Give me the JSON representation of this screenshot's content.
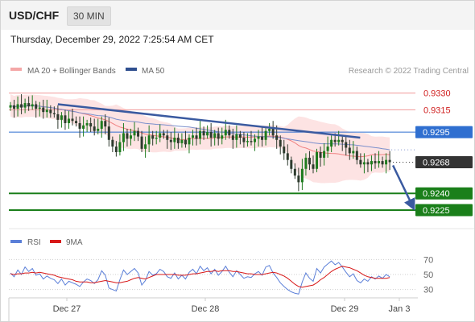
{
  "header": {
    "symbol": "USD/CHF",
    "timeframe": "30 MIN",
    "datetime": "Thursday, December 29, 2022 7:25:54 AM CET"
  },
  "legend": {
    "ma20": "MA 20 + Bollinger Bands",
    "ma50": "MA 50",
    "credit": "Research © 2022 Trading Central"
  },
  "rsi_legend": {
    "rsi": "RSI",
    "ma9": "9MA"
  },
  "colors": {
    "candle_up": "#1e7b1e",
    "candle_down": "#2e3b2e",
    "band_fill": "#fde3e3",
    "ma20": "#f08080",
    "ma50": "#7b8fcc",
    "trendline": "#3a5aa0",
    "support": "#1a7f1a",
    "resistance": "#f19a9a",
    "pivot": "#2f6fd0",
    "current": "#333333",
    "rsi": "#5b7fd8",
    "rsi_ma": "#d81818"
  },
  "chart_data": [
    {
      "type": "candlestick",
      "title": "USD/CHF",
      "ylim": [
        0.9212,
        0.9342
      ],
      "x_ticks": [
        "Dec 27",
        "Dec 28",
        "Dec 29",
        "Jan 3"
      ],
      "price_levels": [
        {
          "label": "0.9330",
          "value": 0.933,
          "kind": "resistance"
        },
        {
          "label": "0.9315",
          "value": 0.9315,
          "kind": "resistance"
        },
        {
          "label": "0.9295",
          "value": 0.9295,
          "kind": "pivot"
        },
        {
          "label": "0.9268",
          "value": 0.9268,
          "kind": "current"
        },
        {
          "label": "0.9240",
          "value": 0.924,
          "kind": "support"
        },
        {
          "label": "0.9225",
          "value": 0.9225,
          "kind": "support"
        }
      ],
      "series": [
        {
          "name": "Price",
          "close": [
            0.9319,
            0.9316,
            0.932,
            0.9317,
            0.9321,
            0.9318,
            0.932,
            0.9316,
            0.9317,
            0.9313,
            0.9315,
            0.9312,
            0.9311,
            0.9306,
            0.931,
            0.9303,
            0.9307,
            0.9305,
            0.9303,
            0.9298,
            0.9301,
            0.9303,
            0.93,
            0.9296,
            0.9298,
            0.9305,
            0.93,
            0.9288,
            0.9282,
            0.9277,
            0.9286,
            0.9294,
            0.9289,
            0.9292,
            0.9296,
            0.9291,
            0.928,
            0.9284,
            0.9292,
            0.9289,
            0.929,
            0.9294,
            0.9292,
            0.9288,
            0.9286,
            0.929,
            0.9285,
            0.9288,
            0.9284,
            0.929,
            0.9292,
            0.9289,
            0.9296,
            0.9292,
            0.9295,
            0.929,
            0.9294,
            0.9289,
            0.9292,
            0.9297,
            0.9292,
            0.9288,
            0.9293,
            0.929,
            0.9286,
            0.9287,
            0.9286,
            0.9289,
            0.9291,
            0.9288,
            0.9296,
            0.9298,
            0.9292,
            0.9288,
            0.9282,
            0.9276,
            0.927,
            0.9262,
            0.9256,
            0.925,
            0.9262,
            0.9272,
            0.9266,
            0.9262,
            0.9277,
            0.9272,
            0.9278,
            0.9282,
            0.9288,
            0.9286,
            0.9288,
            0.9286,
            0.9281,
            0.9276,
            0.9278,
            0.927,
            0.9266,
            0.9268,
            0.9266,
            0.9269,
            0.9267,
            0.9269,
            0.9266,
            0.927,
            0.9268
          ]
        },
        {
          "name": "MA 20"
        },
        {
          "name": "MA 50"
        }
      ],
      "trendline": {
        "from": {
          "index": 13,
          "value": 0.932
        },
        "to": {
          "index": 129,
          "value": 0.929
        }
      },
      "projection": {
        "to_value": 0.9225
      }
    },
    {
      "type": "line",
      "title": "RSI",
      "ylim": [
        20,
        80
      ],
      "y_ticks": [
        70,
        50,
        30
      ],
      "series": [
        {
          "name": "RSI",
          "values": [
            52,
            47,
            56,
            50,
            60,
            54,
            58,
            49,
            51,
            44,
            48,
            45,
            43,
            38,
            44,
            36,
            41,
            39,
            37,
            34,
            40,
            44,
            42,
            38,
            43,
            55,
            49,
            32,
            30,
            28,
            43,
            56,
            50,
            54,
            58,
            52,
            36,
            42,
            54,
            49,
            51,
            57,
            54,
            47,
            45,
            52,
            44,
            49,
            44,
            53,
            57,
            51,
            61,
            55,
            59,
            51,
            57,
            49,
            54,
            61,
            53,
            47,
            55,
            50,
            45,
            47,
            46,
            51,
            54,
            49,
            60,
            62,
            52,
            46,
            39,
            34,
            30,
            27,
            25,
            24,
            40,
            52,
            45,
            41,
            58,
            52,
            60,
            64,
            68,
            63,
            66,
            60,
            53,
            47,
            51,
            42,
            39,
            44,
            41,
            47,
            44,
            48,
            45,
            50,
            47
          ]
        },
        {
          "name": "9MA",
          "values": [
            51,
            50,
            51,
            51,
            52,
            52,
            53,
            52,
            53,
            52,
            51,
            50,
            49,
            47,
            46,
            45,
            44,
            43,
            41,
            40,
            40,
            40,
            39,
            39,
            40,
            41,
            42,
            41,
            40,
            39,
            39,
            40,
            41,
            43,
            45,
            46,
            45,
            44,
            46,
            48,
            50,
            50,
            50,
            50,
            50,
            50,
            49,
            49,
            49,
            50,
            51,
            51,
            52,
            53,
            54,
            54,
            55,
            54,
            55,
            55,
            55,
            54,
            54,
            53,
            52,
            51,
            51,
            50,
            50,
            50,
            51,
            52,
            53,
            52,
            50,
            48,
            45,
            41,
            37,
            34,
            33,
            34,
            35,
            36,
            39,
            43,
            46,
            50,
            54,
            57,
            59,
            61,
            60,
            59,
            57,
            55,
            52,
            49,
            47,
            46,
            45,
            45,
            45,
            45,
            46
          ]
        }
      ]
    }
  ]
}
